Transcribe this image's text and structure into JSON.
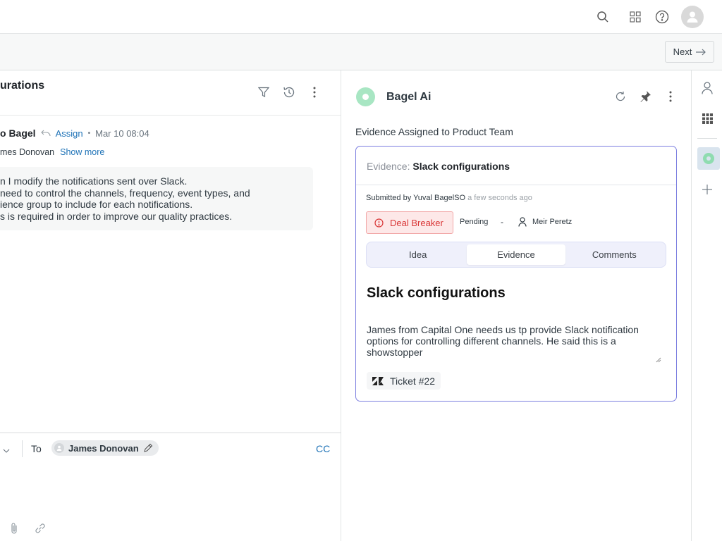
{
  "topbar": {
    "icons": [
      "search-icon",
      "apps-grid-icon",
      "help-icon",
      "user-avatar-icon"
    ]
  },
  "subbar": {
    "next_label": "Next"
  },
  "ticket_panel": {
    "title": "urations",
    "header_icons": [
      "filter-icon",
      "history-icon",
      "more-vertical-icon"
    ],
    "message": {
      "sender": "o Bagel",
      "assign_label": "Assign",
      "separator": "•",
      "timestamp": "Mar 10 08:04",
      "to_line": "mes Donovan",
      "show_more_label": "Show more",
      "body_lines": [
        "n I modify the notifications sent over Slack.",
        " need to control the channels, frequency, event types, and",
        "ience group to include for each notifications.",
        "s is required in order to improve our quality practices."
      ]
    },
    "composer": {
      "to_label": "To",
      "recipient": "James Donovan",
      "cc_label": "CC"
    }
  },
  "bagel_panel": {
    "app_name": "Bagel Ai",
    "assigned_text": "Evidence Assigned to Product Team",
    "card": {
      "header_label": "Evidence:",
      "header_value": "Slack configurations",
      "submitted_prefix": "Submitted by",
      "submitted_by": "Yuval BagelSO",
      "submitted_ago": "a few seconds ago",
      "priority_label": "Deal Breaker",
      "status": "Pending",
      "dash": "-",
      "assignee": "Meir Peretz",
      "tabs": [
        {
          "label": "Idea",
          "active": false
        },
        {
          "label": "Evidence",
          "active": true
        },
        {
          "label": "Comments",
          "active": false
        }
      ],
      "title": "Slack configurations",
      "description": "James from Capital One needs us tp provide Slack notification options for controlling different channels. He said this is a showstopper",
      "ticket_label": "Ticket #22"
    },
    "colors": {
      "accent_border": "#7c7fe0",
      "deal_breaker_text": "#d93636",
      "deal_breaker_bg": "#fde8e8",
      "bagel_green": "#a8e6c3",
      "link_blue": "#1f73b7"
    }
  }
}
